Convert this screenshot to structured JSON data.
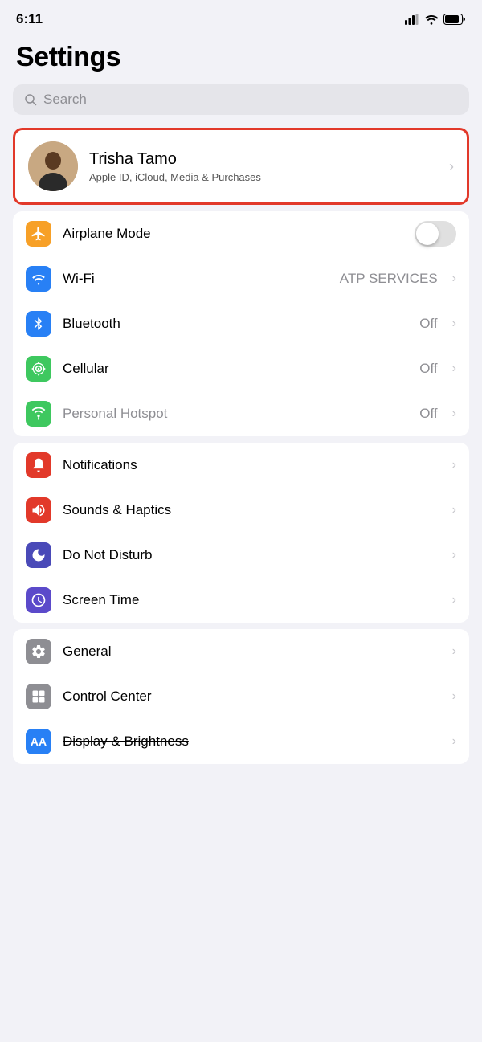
{
  "statusBar": {
    "time": "6:11",
    "batteryLevel": 80
  },
  "header": {
    "title": "Settings"
  },
  "search": {
    "placeholder": "Search"
  },
  "profile": {
    "name": "Trisha Tamo",
    "subtitle": "Apple ID, iCloud, Media & Purchases"
  },
  "sections": [
    {
      "id": "connectivity",
      "items": [
        {
          "id": "airplane-mode",
          "label": "Airplane Mode",
          "iconColor": "#f7a027",
          "iconType": "airplane",
          "controlType": "toggle",
          "value": "",
          "enabled": false
        },
        {
          "id": "wifi",
          "label": "Wi-Fi",
          "iconColor": "#2880f5",
          "iconType": "wifi",
          "controlType": "value-chevron",
          "value": "ATP SERVICES",
          "enabled": true
        },
        {
          "id": "bluetooth",
          "label": "Bluetooth",
          "iconColor": "#2880f5",
          "iconType": "bluetooth",
          "controlType": "value-chevron",
          "value": "Off",
          "enabled": true
        },
        {
          "id": "cellular",
          "label": "Cellular",
          "iconColor": "#3ec85f",
          "iconType": "cellular",
          "controlType": "value-chevron",
          "value": "Off",
          "enabled": true
        },
        {
          "id": "hotspot",
          "label": "Personal Hotspot",
          "iconColor": "#3ec85f",
          "iconType": "hotspot",
          "controlType": "value-chevron",
          "value": "Off",
          "enabled": false
        }
      ]
    },
    {
      "id": "system",
      "items": [
        {
          "id": "notifications",
          "label": "Notifications",
          "iconColor": "#e2392a",
          "iconType": "notifications",
          "controlType": "chevron",
          "value": ""
        },
        {
          "id": "sounds",
          "label": "Sounds & Haptics",
          "iconColor": "#e2392a",
          "iconType": "sounds",
          "controlType": "chevron",
          "value": ""
        },
        {
          "id": "dnd",
          "label": "Do Not Disturb",
          "iconColor": "#4a4ab8",
          "iconType": "dnd",
          "controlType": "chevron",
          "value": ""
        },
        {
          "id": "screentime",
          "label": "Screen Time",
          "iconColor": "#5b4aca",
          "iconType": "screentime",
          "controlType": "chevron",
          "value": ""
        }
      ]
    },
    {
      "id": "device",
      "items": [
        {
          "id": "general",
          "label": "General",
          "iconColor": "#8e8e93",
          "iconType": "general",
          "controlType": "chevron",
          "value": ""
        },
        {
          "id": "controlcenter",
          "label": "Control Center",
          "iconColor": "#8e8e93",
          "iconType": "controlcenter",
          "controlType": "chevron",
          "value": ""
        },
        {
          "id": "display",
          "label": "Display & Brightness",
          "iconColor": "#2880f5",
          "iconType": "display",
          "controlType": "chevron",
          "value": "",
          "strikethrough": true
        }
      ]
    }
  ]
}
